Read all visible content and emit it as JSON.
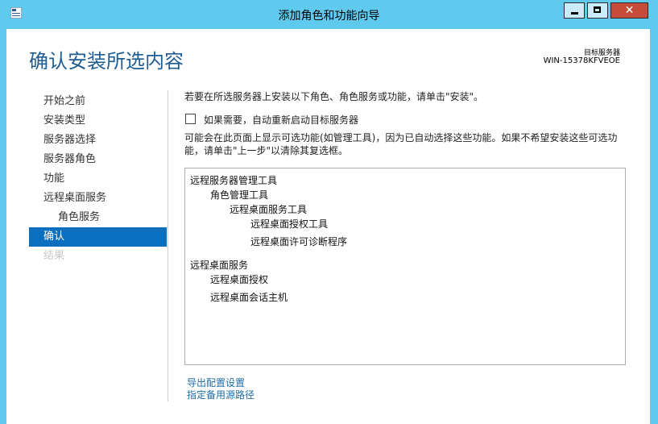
{
  "window": {
    "title": "添加角色和功能向导",
    "controls": {
      "minimize": "minimize-icon",
      "maximize": "maximize-icon",
      "close": "✕"
    }
  },
  "header": {
    "page_title": "确认安装所选内容",
    "destination_label": "目标服务器",
    "destination_server": "WIN-15378KFVEOE"
  },
  "nav": {
    "items": [
      {
        "label": "开始之前",
        "state": "normal"
      },
      {
        "label": "安装类型",
        "state": "normal"
      },
      {
        "label": "服务器选择",
        "state": "normal"
      },
      {
        "label": "服务器角色",
        "state": "normal"
      },
      {
        "label": "功能",
        "state": "normal"
      },
      {
        "label": "远程桌面服务",
        "state": "normal"
      },
      {
        "label": "角色服务",
        "state": "sub"
      },
      {
        "label": "确认",
        "state": "active"
      },
      {
        "label": "结果",
        "state": "disabled"
      }
    ]
  },
  "main": {
    "intro": "若要在所选服务器上安装以下角色、角色服务或功能，请单击\"安装\"。",
    "restart_checkbox": {
      "label": "如果需要，自动重新启动目标服务器",
      "checked": false
    },
    "note": "可能会在此页面上显示可选功能(如管理工具)，因为已自动选择这些功能。如果不希望安装这些可选功能，请单击\"上一步\"以清除其复选框。",
    "tree": [
      "远程服务器管理工具",
      "角色管理工具",
      "远程桌面服务工具",
      "远程桌面授权工具",
      "远程桌面许可诊断程序",
      "远程桌面服务",
      "远程桌面授权",
      "远程桌面会话主机"
    ],
    "links": {
      "export": "导出配置设置",
      "alternate_source": "指定备用源路径"
    }
  },
  "colors": {
    "titlebar": "#5fcaee",
    "close_button": "#c74b39",
    "page_title": "#1e5d92",
    "nav_active": "#0a6fbf",
    "link": "#1e6ea8"
  }
}
